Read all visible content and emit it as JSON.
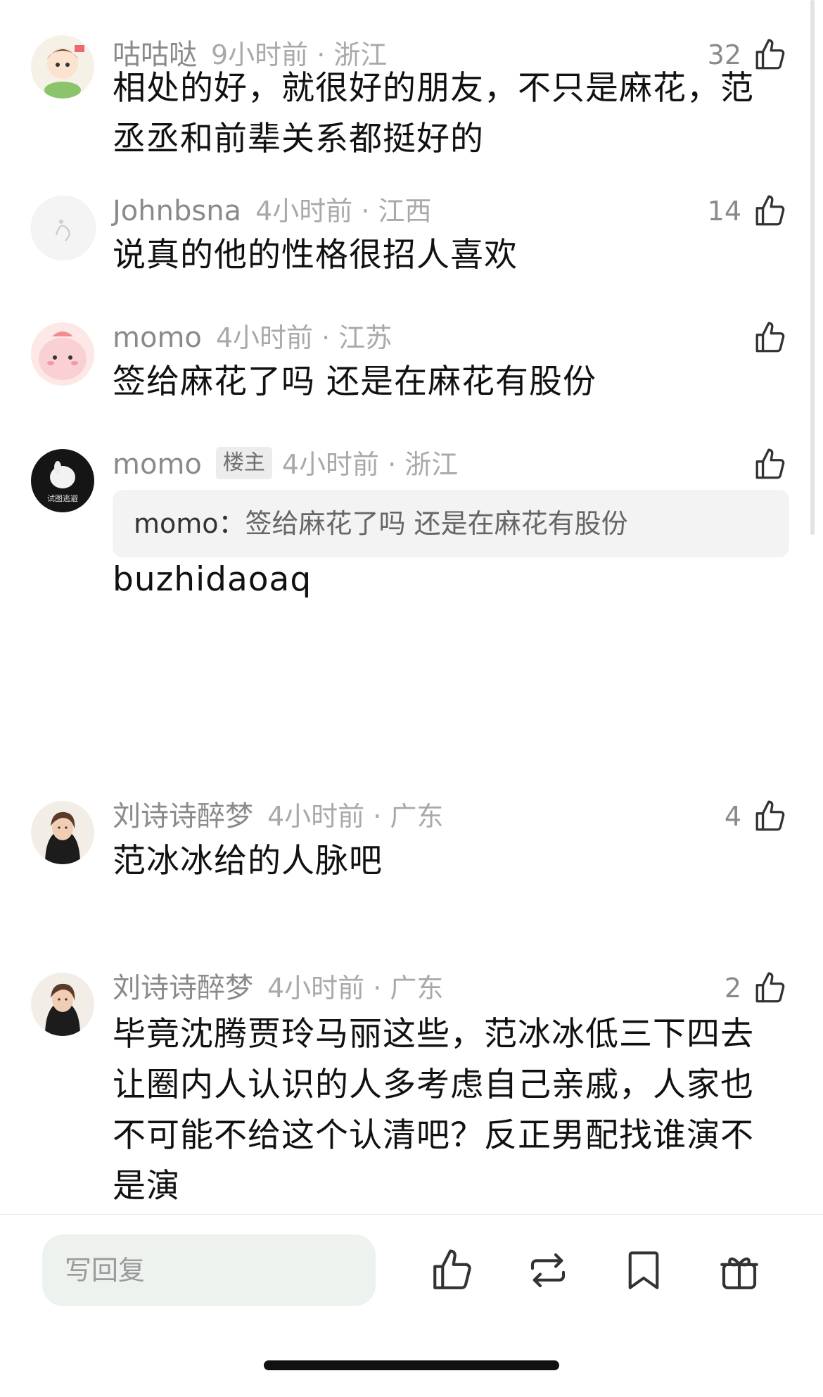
{
  "comments": [
    {
      "username": "咕咕哒",
      "time_location": "9小时前 · 浙江",
      "likes": "32",
      "text": "相处的好，就很好的朋友，不只是麻花，范丞丞和前辈关系都挺好的"
    },
    {
      "username": "Johnbsna",
      "time_location": "4小时前 · 江西",
      "likes": "14",
      "text": "说真的他的性格很招人喜欢"
    },
    {
      "username": "momo",
      "time_location": "4小时前 · 江苏",
      "likes": "",
      "text": "签给麻花了吗 还是在麻花有股份"
    },
    {
      "username": "momo",
      "badge": "楼主",
      "avatar_caption": "试图逃避",
      "time_location": "4小时前 · 浙江",
      "likes": "",
      "quote_author": "momo：",
      "quote_text": "签给麻花了吗 还是在麻花有股份",
      "text": "buzhidaoaq"
    },
    {
      "username": "刘诗诗醉梦",
      "time_location": "4小时前 · 广东",
      "likes": "4",
      "text": "范冰冰给的人脉吧"
    },
    {
      "username": "刘诗诗醉梦",
      "time_location": "4小时前 · 广东",
      "likes": "2",
      "text": "毕竟沈腾贾玲马丽这些，范冰冰低三下四去让圈内人认识的人多考虑自己亲戚，人家也不可能不给这个认清吧？反正男配找谁演不是演"
    }
  ],
  "bottom_bar": {
    "reply_placeholder": "写回复",
    "icons": [
      "thumbs-up-icon",
      "repost-icon",
      "bookmark-icon",
      "gift-icon"
    ]
  },
  "colors": {
    "username": "#8a8a8a",
    "meta": "#a9a9a9",
    "text": "#111111",
    "quote_bg": "#f3f3f3",
    "input_bg": "#eef2ef"
  }
}
